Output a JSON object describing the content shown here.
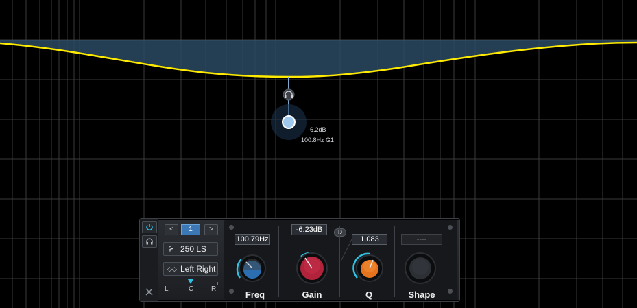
{
  "eq_graph": {
    "band_gain_label": "-6.2dB",
    "band_freq_label": "100.8Hz G1"
  },
  "band_panel": {
    "band_number": "1",
    "prev_label": "<",
    "next_label": ">",
    "filter_type": "250 LS",
    "channel_mode": "Left Right",
    "pan_labels": {
      "left": "L",
      "center": "C",
      "right": "R"
    },
    "freq": {
      "value": "100.79Hz",
      "label": "Freq"
    },
    "gain": {
      "value": "-6.23dB",
      "label": "Gain"
    },
    "dynamic_badge": "D",
    "q": {
      "value": "1.083",
      "label": "Q"
    },
    "shape": {
      "value": "----",
      "label": "Shape"
    }
  },
  "colors": {
    "curve": "#ffea00",
    "fill": "#2a4a63",
    "accent": "#2ec4e6",
    "freq_knob": "#2c6fb0",
    "gain_knob": "#b0233a",
    "q_knob": "#e5731e"
  },
  "icons": [
    "power-icon",
    "headphones-icon",
    "close-icon",
    "filter-shape-icon",
    "stereo-link-icon"
  ]
}
